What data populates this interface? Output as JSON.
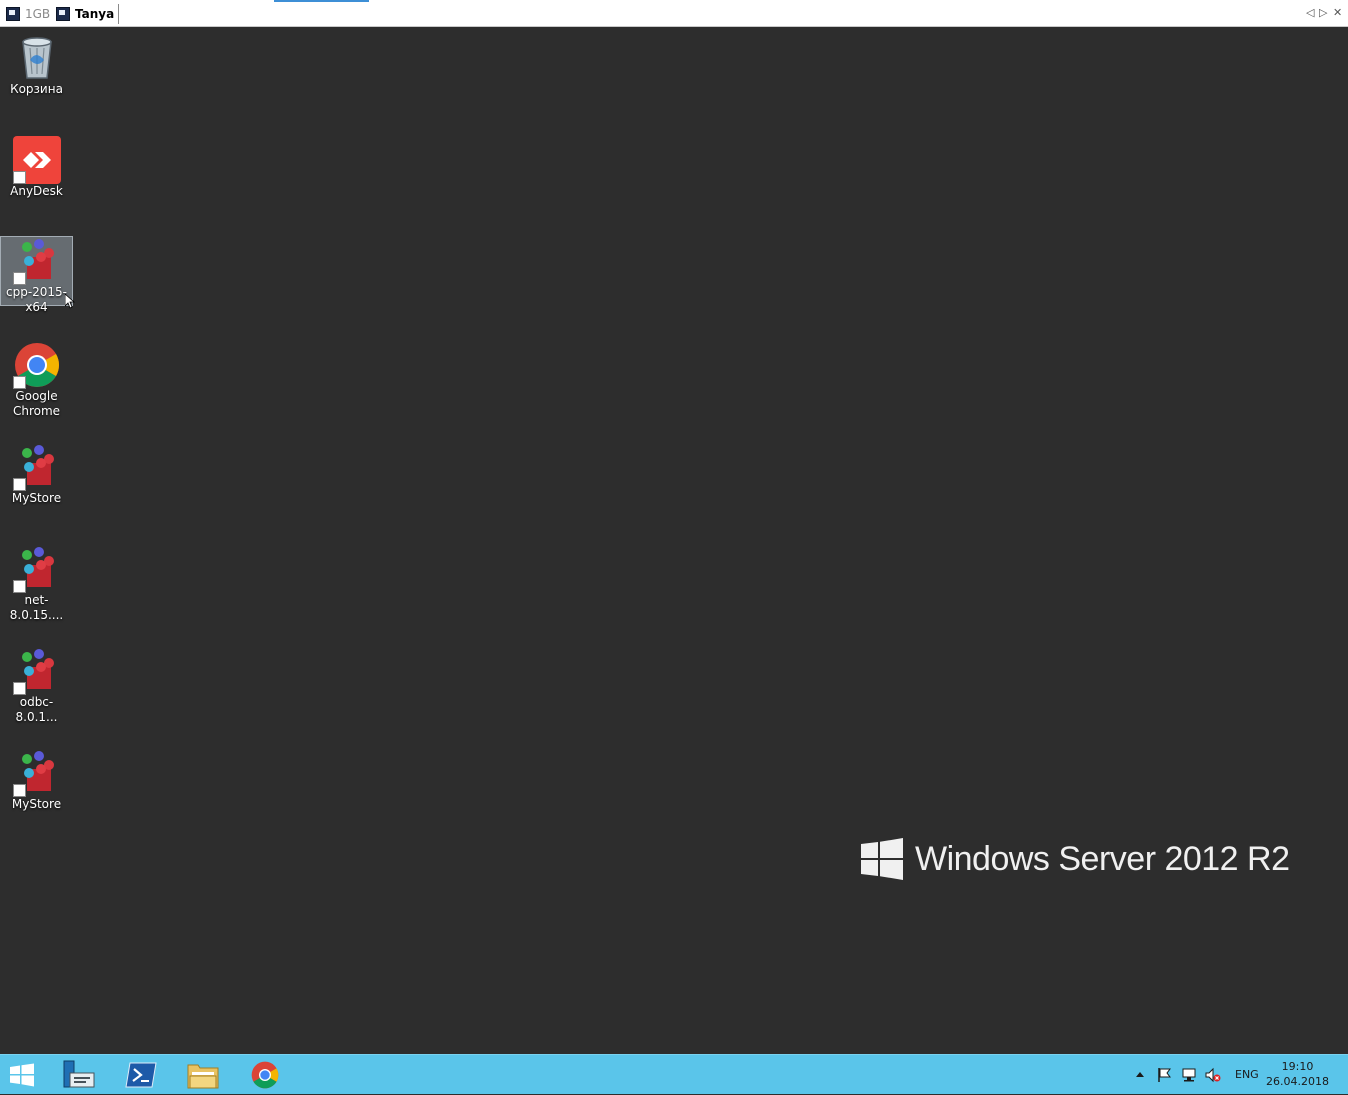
{
  "tabs": [
    {
      "label": "1GB"
    },
    {
      "label": "Tanya"
    }
  ],
  "tab_controls": {
    "prev": "◁",
    "next": "▷",
    "close": "✕"
  },
  "desktop_icons": [
    {
      "label": "Корзина",
      "icon": "recycle-bin-icon"
    },
    {
      "label": "AnyDesk",
      "icon": "anydesk-icon"
    },
    {
      "label": "cpp-2015-x64",
      "icon": "installer-icon",
      "selected": true
    },
    {
      "label": "Google\nChrome",
      "icon": "chrome-icon"
    },
    {
      "label": "MyStore",
      "icon": "installer-icon"
    },
    {
      "label": "net-8.0.15....",
      "icon": "installer-icon"
    },
    {
      "label": "odbc-8.0.1...",
      "icon": "installer-icon"
    },
    {
      "label": "MyStore",
      "icon": "installer-icon"
    }
  ],
  "brand": {
    "text": "Windows Server 2012 R2"
  },
  "taskbar": {
    "apps": [
      "start-icon",
      "server-manager-icon",
      "powershell-icon",
      "file-explorer-icon",
      "chrome-icon"
    ],
    "tray": {
      "language": "ENG",
      "time": "19:10",
      "date": "26.04.2018"
    }
  },
  "colors": {
    "desktop": "#2d2d2d",
    "taskbar": "#5ac5ea",
    "tab_accent": "#3d8fd6"
  }
}
